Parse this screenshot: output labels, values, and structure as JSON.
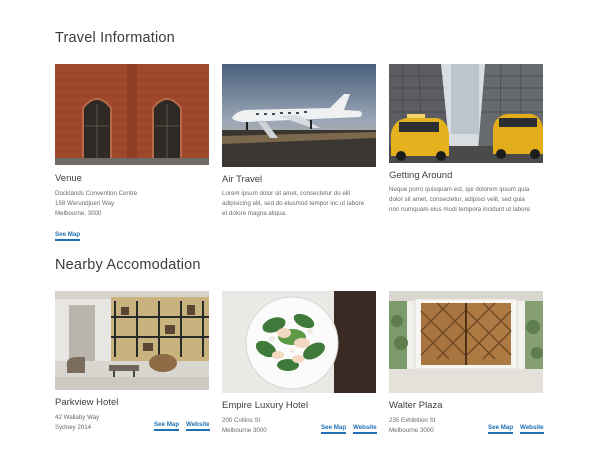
{
  "travel": {
    "title": "Travel Information",
    "cards": [
      {
        "title": "Venue",
        "lines": [
          "Docklands Convention Centre",
          "158 Werundjueri Way",
          "Melbourne, 3000"
        ],
        "link": "See Map"
      },
      {
        "title": "Air Travel",
        "lines": [
          "Lorem ipsum dolor sit amet, consectetur do elit",
          "adipisicing elit, sed do eiusmod tempor inc ut labore",
          "et dolore magna aliqua."
        ]
      },
      {
        "title": "Getting Around",
        "lines": [
          "Neque porro quisquam est, qui dolorem ipsum quia",
          "dolor sit amet, consectetur, adipisci velit, sed quia",
          "non numquam eius modi tempora incidunt ut labore"
        ]
      }
    ]
  },
  "accommodation": {
    "title": "Nearby Accomodation",
    "hotels": [
      {
        "name": "Parkview Hotel",
        "address": [
          "42 Wallaby Way",
          "Sydney 2014"
        ],
        "map_label": "See Map",
        "website_label": "Website"
      },
      {
        "name": "Empire Luxury Hotel",
        "address": [
          "200 Collins St",
          "Melbourne 3000"
        ],
        "map_label": "See Map",
        "website_label": "Website"
      },
      {
        "name": "Walter Plaza",
        "address": [
          "235 Exhibition St",
          "Melbourne 3000"
        ],
        "map_label": "See Map",
        "website_label": "Website"
      }
    ]
  },
  "colors": {
    "link": "#1f6fb2",
    "heading": "#3c3c3c",
    "body_text": "#6b6b6b"
  }
}
